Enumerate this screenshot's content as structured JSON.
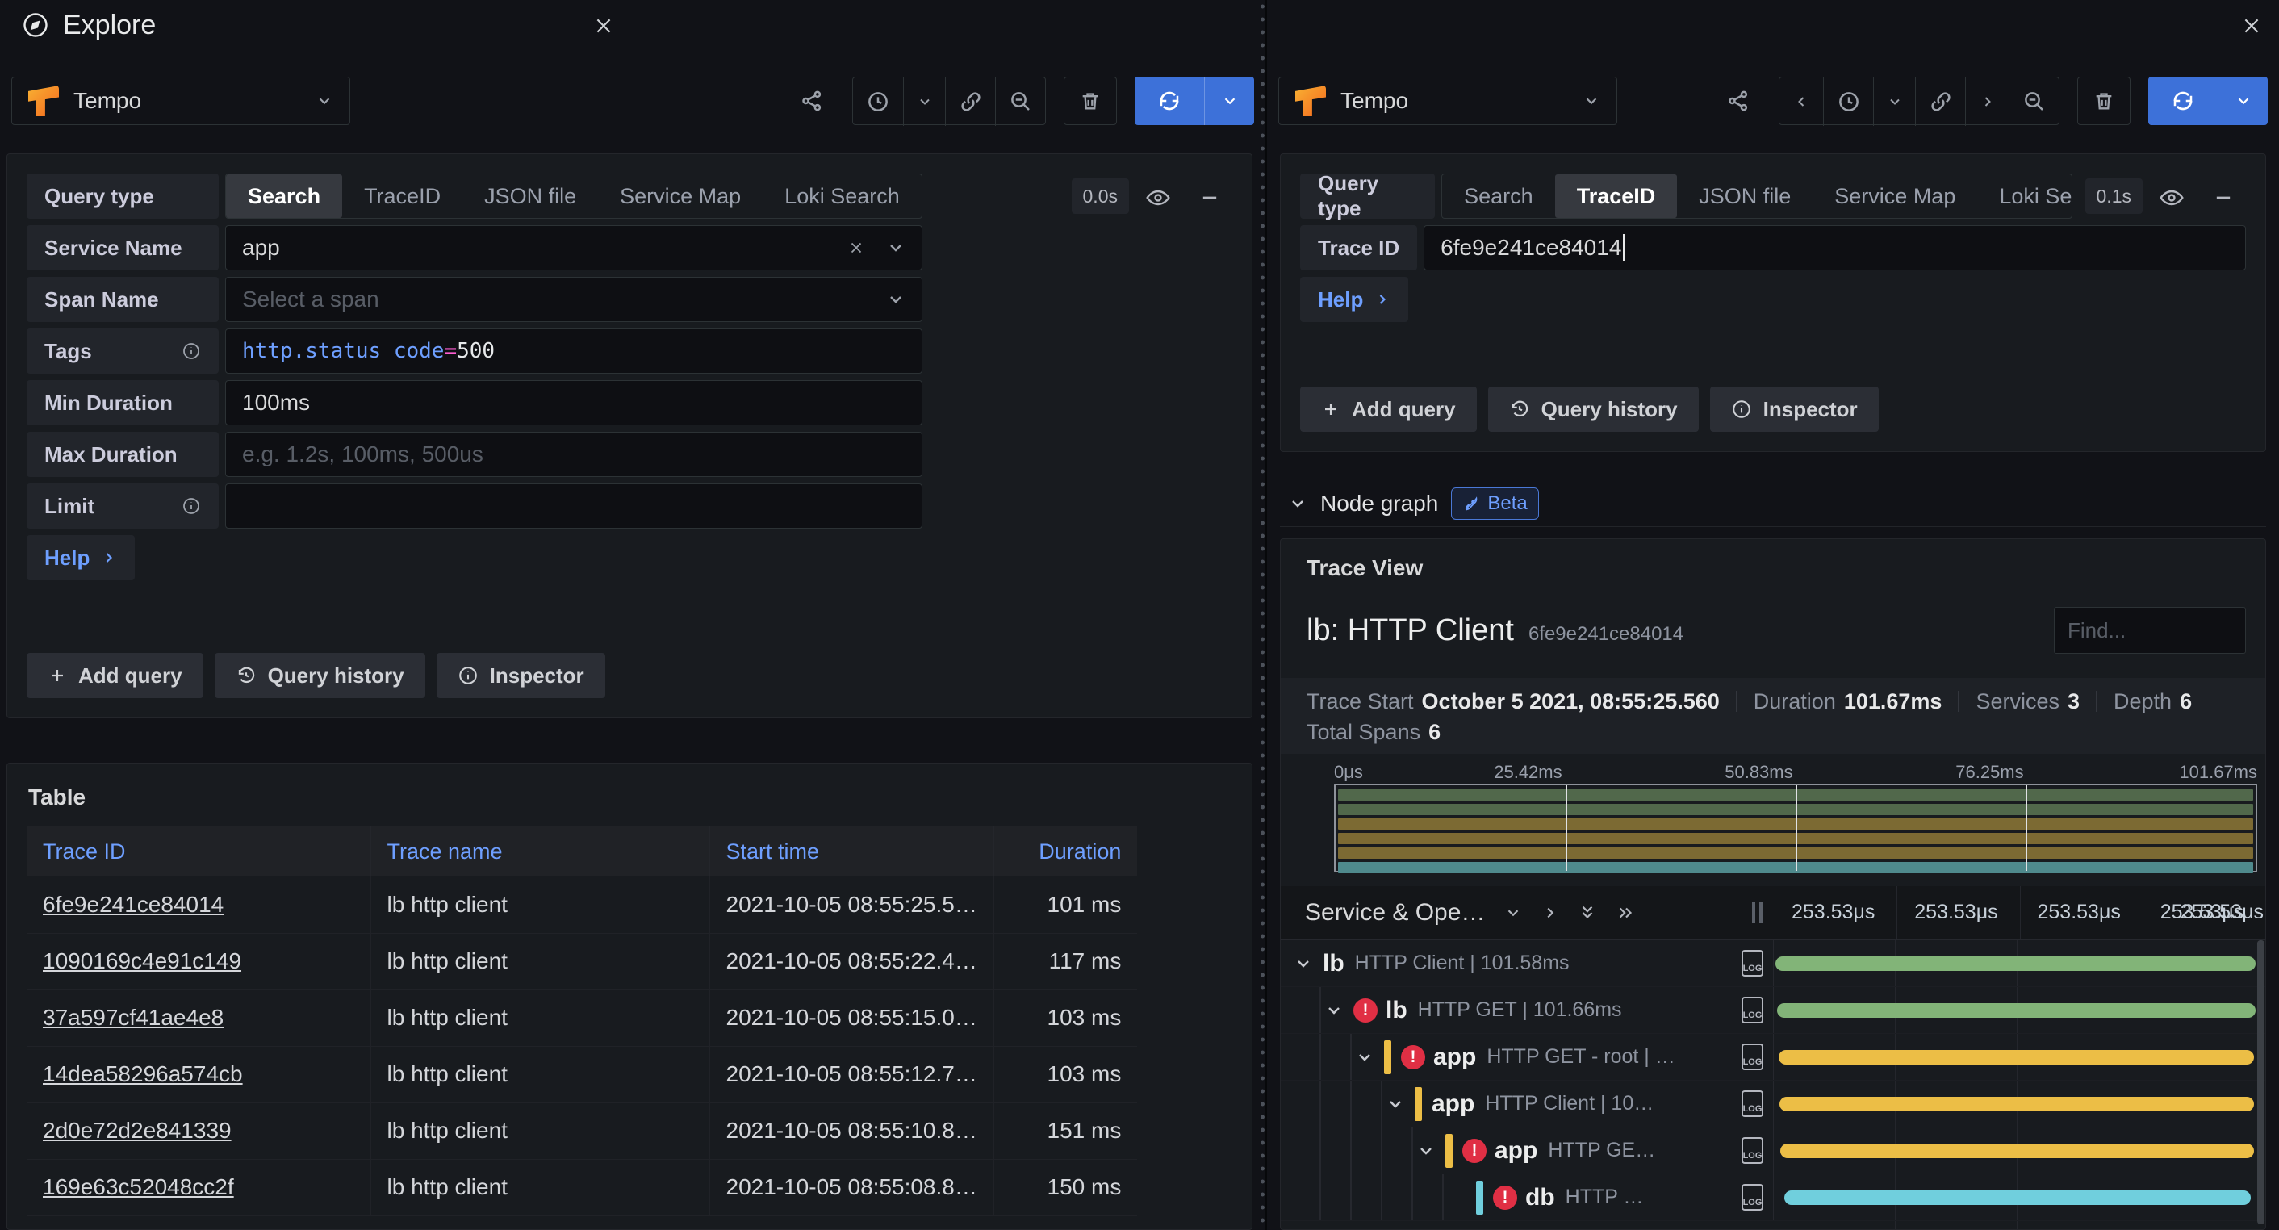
{
  "header": {
    "title": "Explore"
  },
  "colors": {
    "accent_blue": "#3d71d9",
    "link_blue": "#6e9fff",
    "error_red": "#e02f44",
    "code_key_blue": "#6e9fff",
    "code_operator_pink": "#ff5dd2",
    "code_value": "#e6e8ea",
    "bar_green": "#82b478",
    "bar_yellow": "#ecbe46",
    "bar_teal": "#70cfdd"
  },
  "icons": {
    "explore": "compass-icon",
    "share": "share-nodes-icon",
    "time": "clock-icon",
    "link": "link-icon",
    "zoom_out": "magnifier-minus-icon",
    "trash": "trash-icon",
    "run": "sync-refresh-icon",
    "eye": "eye-icon",
    "collapse": "minus-icon",
    "log": "log-document-icon",
    "beta": "rocket-icon",
    "error": "exclamation-circle-icon"
  },
  "left": {
    "datasource": "Tempo",
    "query_editor": {
      "query_type_label": "Query type",
      "tabs": [
        {
          "label": "Search"
        },
        {
          "label": "TraceID"
        },
        {
          "label": "JSON file"
        },
        {
          "label": "Service Map"
        },
        {
          "label": "Loki Search"
        }
      ],
      "active_tab": "Search",
      "elapsed": "0.0s",
      "fields": {
        "service_name": {
          "label": "Service Name",
          "value": "app"
        },
        "span_name": {
          "label": "Span Name",
          "placeholder": "Select a span"
        },
        "tags": {
          "label": "Tags",
          "key": "http.status_code",
          "operator": "=",
          "value": "500"
        },
        "min_duration": {
          "label": "Min Duration",
          "value": "100ms"
        },
        "max_duration": {
          "label": "Max Duration",
          "placeholder": "e.g. 1.2s, 100ms, 500us"
        },
        "limit": {
          "label": "Limit",
          "value": ""
        }
      },
      "help_label": "Help",
      "actions": {
        "add_query": "Add query",
        "query_history": "Query history",
        "inspector": "Inspector"
      }
    },
    "table": {
      "title": "Table",
      "columns": [
        "Trace ID",
        "Trace name",
        "Start time",
        "Duration"
      ],
      "rows": [
        {
          "trace_id": "6fe9e241ce84014",
          "trace_name": "lb http client",
          "start_time": "2021-10-05 08:55:25.5…",
          "duration": "101 ms"
        },
        {
          "trace_id": "1090169c4e91c149",
          "trace_name": "lb http client",
          "start_time": "2021-10-05 08:55:22.4…",
          "duration": "117 ms"
        },
        {
          "trace_id": "37a597cf41ae4e8",
          "trace_name": "lb http client",
          "start_time": "2021-10-05 08:55:15.0…",
          "duration": "103 ms"
        },
        {
          "trace_id": "14dea58296a574cb",
          "trace_name": "lb http client",
          "start_time": "2021-10-05 08:55:12.7…",
          "duration": "103 ms"
        },
        {
          "trace_id": "2d0e72d2e841339",
          "trace_name": "lb http client",
          "start_time": "2021-10-05 08:55:10.8…",
          "duration": "151 ms"
        },
        {
          "trace_id": "169e63c52048cc2f",
          "trace_name": "lb http client",
          "start_time": "2021-10-05 08:55:08.8…",
          "duration": "150 ms"
        }
      ]
    }
  },
  "right": {
    "datasource": "Tempo",
    "query_editor": {
      "query_type_label": "Query type",
      "tabs": [
        {
          "label": "Search"
        },
        {
          "label": "TraceID"
        },
        {
          "label": "JSON file"
        },
        {
          "label": "Service Map"
        },
        {
          "label": "Loki Search"
        }
      ],
      "active_tab": "TraceID",
      "elapsed": "0.1s",
      "trace_id_field": {
        "label": "Trace ID",
        "value": "6fe9e241ce84014"
      },
      "help_label": "Help",
      "actions": {
        "add_query": "Add query",
        "query_history": "Query history",
        "inspector": "Inspector"
      }
    },
    "node_graph": {
      "label": "Node graph",
      "beta_label": "Beta"
    },
    "trace_view": {
      "panel_title": "Trace View",
      "trace_title": "lb: HTTP Client",
      "trace_id": "6fe9e241ce84014",
      "find_placeholder": "Find...",
      "meta": {
        "trace_start_label": "Trace Start",
        "trace_start": "October 5 2021, 08:55:25.560",
        "duration_label": "Duration",
        "duration": "101.67ms",
        "services_label": "Services",
        "services": "3",
        "depth_label": "Depth",
        "depth": "6",
        "total_spans_label": "Total Spans",
        "total_spans": "6"
      },
      "ruler_ticks": [
        "0μs",
        "25.42ms",
        "50.83ms",
        "76.25ms",
        "101.67ms"
      ],
      "minimap_colors": [
        "#51684b",
        "#51684b",
        "#7c6a33",
        "#7c6a33",
        "#7c6a33",
        "#4f8a8d"
      ],
      "header": {
        "column_title": "Service & Ope…",
        "tick_label": "253.53μs"
      },
      "log_label": "LOG",
      "spans": [
        {
          "service": "lb",
          "operation": "HTTP Client | 101.58ms",
          "depth": 0,
          "error": false,
          "color": "#82b478",
          "bar_left": "0.4%",
          "bar_width": "99.2%"
        },
        {
          "service": "lb",
          "operation": "HTTP GET | 101.66ms",
          "depth": 1,
          "error": true,
          "color": "#82b478",
          "bar_left": "0.6%",
          "bar_width": "99.0%"
        },
        {
          "service": "app",
          "operation": "HTTP GET - root | …",
          "depth": 2,
          "error": true,
          "color": "#ecbe46",
          "bar_left": "1.0%",
          "bar_width": "98.4%"
        },
        {
          "service": "app",
          "operation": "HTTP Client | 10…",
          "depth": 3,
          "error": false,
          "color": "#ecbe46",
          "bar_left": "1.2%",
          "bar_width": "98.2%"
        },
        {
          "service": "app",
          "operation": "HTTP GE…",
          "depth": 4,
          "error": true,
          "color": "#ecbe46",
          "bar_left": "1.4%",
          "bar_width": "98.0%"
        },
        {
          "service": "db",
          "operation": "HTTP …",
          "depth": 5,
          "error": true,
          "color": "#70cfdd",
          "bar_left": "2.2%",
          "bar_width": "96.4%"
        }
      ]
    }
  }
}
